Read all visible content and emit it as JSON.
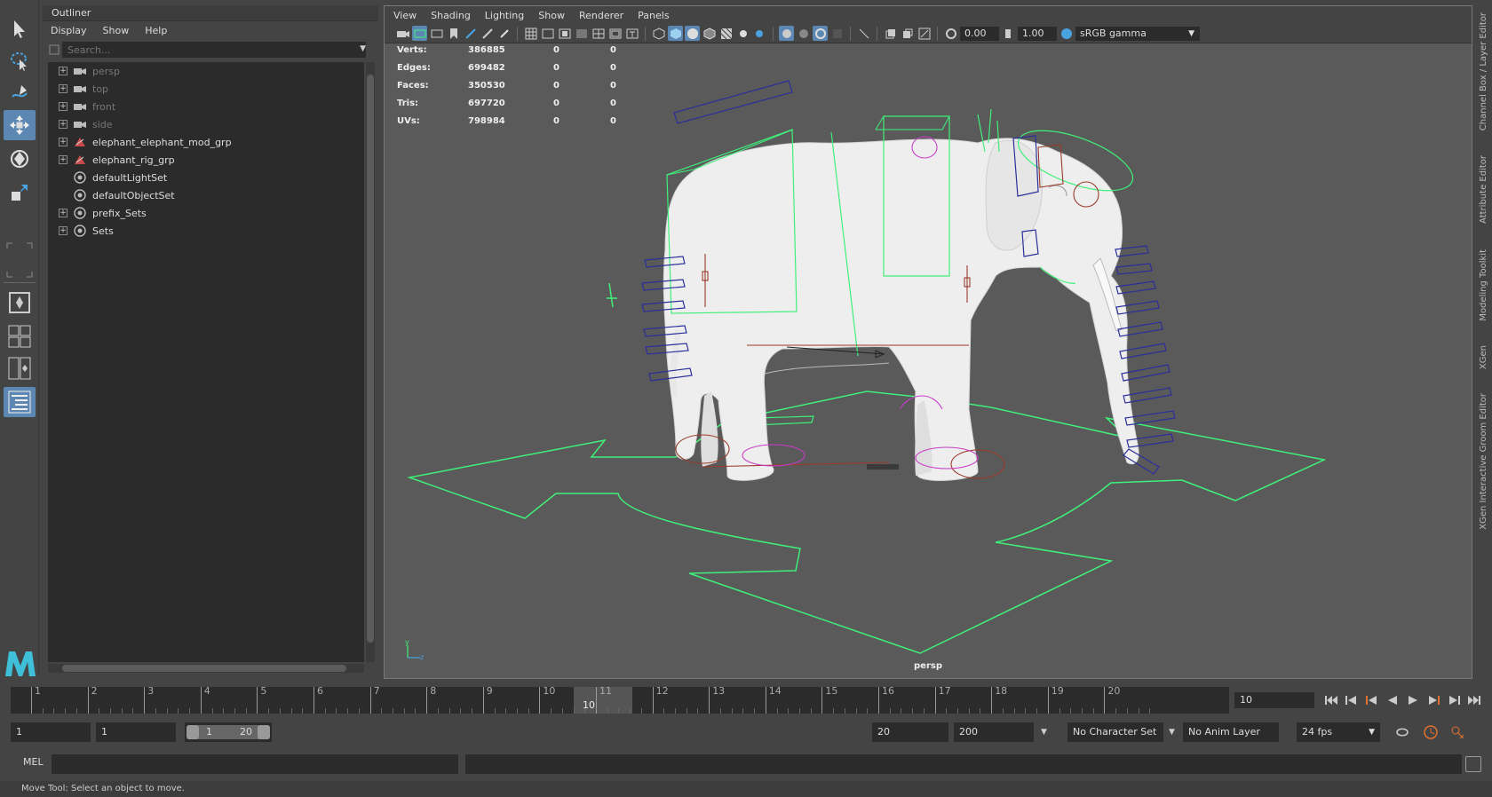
{
  "outliner": {
    "title": "Outliner",
    "menu": [
      "Display",
      "Show",
      "Help"
    ],
    "search_placeholder": "Search...",
    "items": [
      {
        "label": "persp",
        "type": "camera",
        "dim": true,
        "expand": true
      },
      {
        "label": "top",
        "type": "camera",
        "dim": true,
        "expand": true
      },
      {
        "label": "front",
        "type": "camera",
        "dim": true,
        "expand": true
      },
      {
        "label": "side",
        "type": "camera",
        "dim": true,
        "expand": true
      },
      {
        "label": "elephant_elephant_mod_grp",
        "type": "group",
        "dim": false,
        "expand": true
      },
      {
        "label": "elephant_rig_grp",
        "type": "group",
        "dim": false,
        "expand": true
      },
      {
        "label": "defaultLightSet",
        "type": "set",
        "dim": false,
        "expand": false
      },
      {
        "label": "defaultObjectSet",
        "type": "set",
        "dim": false,
        "expand": false
      },
      {
        "label": "prefix_Sets",
        "type": "set",
        "dim": false,
        "expand": true
      },
      {
        "label": "Sets",
        "type": "set",
        "dim": false,
        "expand": true
      }
    ]
  },
  "viewport": {
    "menu": [
      "View",
      "Shading",
      "Lighting",
      "Show",
      "Renderer",
      "Panels"
    ],
    "exposure": "0.00",
    "gamma": "1.00",
    "color_space": "sRGB gamma",
    "camera_label": "persp",
    "hud": {
      "rows": [
        {
          "key": "Verts:",
          "val": "386885",
          "a": "0",
          "b": "0"
        },
        {
          "key": "Edges:",
          "val": "699482",
          "a": "0",
          "b": "0"
        },
        {
          "key": "Faces:",
          "val": "350530",
          "a": "0",
          "b": "0"
        },
        {
          "key": "Tris:",
          "val": "697720",
          "a": "0",
          "b": "0"
        },
        {
          "key": "UVs:",
          "val": "798984",
          "a": "0",
          "b": "0"
        }
      ]
    },
    "axis": {
      "y": "y",
      "z": "z"
    }
  },
  "right_tabs": [
    "Channel Box / Layer Editor",
    "Attribute Editor",
    "Modeling Toolkit",
    "XGen",
    "XGen Interactive Groom Editor"
  ],
  "timeline": {
    "ticks": [
      "1",
      "2",
      "3",
      "4",
      "5",
      "6",
      "7",
      "8",
      "9",
      "10",
      "11",
      "12",
      "13",
      "14",
      "15",
      "16",
      "17",
      "18",
      "19",
      "20"
    ],
    "current_label": "10",
    "current_frame": "10"
  },
  "range": {
    "start": "1",
    "playback_start": "1",
    "slider_start": "1",
    "slider_end": "20",
    "playback_end": "20",
    "end": "200",
    "character_set": "No Character Set",
    "anim_layer": "No Anim Layer",
    "fps": "24 fps"
  },
  "command": {
    "mel_label": "MEL",
    "help": "Move Tool: Select an object to move."
  },
  "colors": {
    "accent": "#5d87b3",
    "control_green": "#3ff07a",
    "joint_blue": "#2a2f9a",
    "magenta": "#c83cc8",
    "red": "#9a3b2a"
  }
}
